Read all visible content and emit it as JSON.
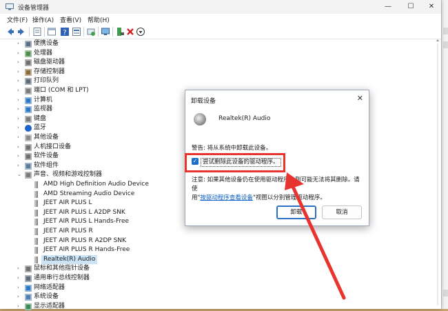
{
  "window": {
    "title": "设备管理器",
    "buttons": [
      "—",
      "☐",
      "✕"
    ]
  },
  "menu": [
    "文件(F)",
    "操作(A)",
    "查看(V)",
    "帮助(H)"
  ],
  "toolbar_icons": [
    "back-icon",
    "forward-icon",
    "properties-icon",
    "help-icon",
    "window-icon",
    "scan-icon",
    "monitor-icon",
    "update-driver-icon",
    "uninstall-icon",
    "download-icon"
  ],
  "tree": [
    {
      "label": "便携设备",
      "indent": 0,
      "expanded": false,
      "icon": "portable-device-icon"
    },
    {
      "label": "处理器",
      "indent": 0,
      "expanded": false,
      "icon": "processor-icon"
    },
    {
      "label": "磁盘驱动器",
      "indent": 0,
      "expanded": false,
      "icon": "disk-drive-icon"
    },
    {
      "label": "存储控制器",
      "indent": 0,
      "expanded": false,
      "icon": "storage-controller-icon"
    },
    {
      "label": "打印队列",
      "indent": 0,
      "expanded": false,
      "icon": "print-queue-icon"
    },
    {
      "label": "端口 (COM 和 LPT)",
      "indent": 0,
      "expanded": false,
      "icon": "port-icon"
    },
    {
      "label": "计算机",
      "indent": 0,
      "expanded": false,
      "icon": "computer-icon"
    },
    {
      "label": "监视器",
      "indent": 0,
      "expanded": false,
      "icon": "monitor-icon"
    },
    {
      "label": "键盘",
      "indent": 0,
      "expanded": false,
      "icon": "keyboard-icon"
    },
    {
      "label": "蓝牙",
      "indent": 0,
      "expanded": false,
      "icon": "bluetooth-icon"
    },
    {
      "label": "其他设备",
      "indent": 0,
      "expanded": false,
      "icon": "other-device-icon"
    },
    {
      "label": "人机接口设备",
      "indent": 0,
      "expanded": false,
      "icon": "hid-icon"
    },
    {
      "label": "软件设备",
      "indent": 0,
      "expanded": false,
      "icon": "software-device-icon"
    },
    {
      "label": "软件组件",
      "indent": 0,
      "expanded": false,
      "icon": "software-component-icon"
    },
    {
      "label": "声音、视频和游戏控制器",
      "indent": 0,
      "expanded": true,
      "icon": "sound-icon"
    },
    {
      "label": "AMD High Definition Audio Device",
      "indent": 1,
      "icon": "audio-device-icon"
    },
    {
      "label": "AMD Streaming Audio Device",
      "indent": 1,
      "icon": "audio-device-icon"
    },
    {
      "label": "JEET AIR PLUS L",
      "indent": 1,
      "icon": "audio-device-icon"
    },
    {
      "label": "JEET AIR PLUS L A2DP SNK",
      "indent": 1,
      "icon": "audio-device-icon"
    },
    {
      "label": "JEET AIR PLUS L Hands-Free",
      "indent": 1,
      "icon": "audio-device-icon"
    },
    {
      "label": "JEET AIR PLUS R",
      "indent": 1,
      "icon": "audio-device-icon"
    },
    {
      "label": "JEET AIR PLUS R A2DP SNK",
      "indent": 1,
      "icon": "audio-device-icon"
    },
    {
      "label": "JEET AIR PLUS R Hands-Free",
      "indent": 1,
      "icon": "audio-device-icon"
    },
    {
      "label": "Realtek(R) Audio",
      "indent": 1,
      "selected": true,
      "icon": "audio-device-icon"
    },
    {
      "label": "鼠标和其他指针设备",
      "indent": 0,
      "expanded": false,
      "icon": "mouse-icon"
    },
    {
      "label": "通用串行总线控制器",
      "indent": 0,
      "expanded": false,
      "icon": "usb-icon"
    },
    {
      "label": "网络适配器",
      "indent": 0,
      "expanded": false,
      "icon": "network-adapter-icon"
    },
    {
      "label": "系统设备",
      "indent": 0,
      "expanded": false,
      "icon": "system-device-icon"
    },
    {
      "label": "显示适配器",
      "indent": 0,
      "expanded": false,
      "icon": "display-adapter-icon"
    }
  ],
  "dialog": {
    "title": "卸载设备",
    "close": "✕",
    "device_name": "Realtek(R) Audio",
    "warning": "警告: 将从系统中卸载此设备。",
    "checkbox_label": "尝试删除此设备的驱动程序。",
    "checkbox_checked": true,
    "note_line1": "注意: 如果其他设备仍在使用驱动程序，则可能无法将其删除。请使",
    "note_pre": "用\"",
    "note_link": "按驱动程序查看设备",
    "note_post": "\"视图以分别管理驱动程序。",
    "uninstall_button": "卸载",
    "cancel_button": "取消"
  },
  "colors": {
    "accent": "#1a6fc9",
    "highlight": "#e8342e",
    "selection": "#cce4f7"
  }
}
